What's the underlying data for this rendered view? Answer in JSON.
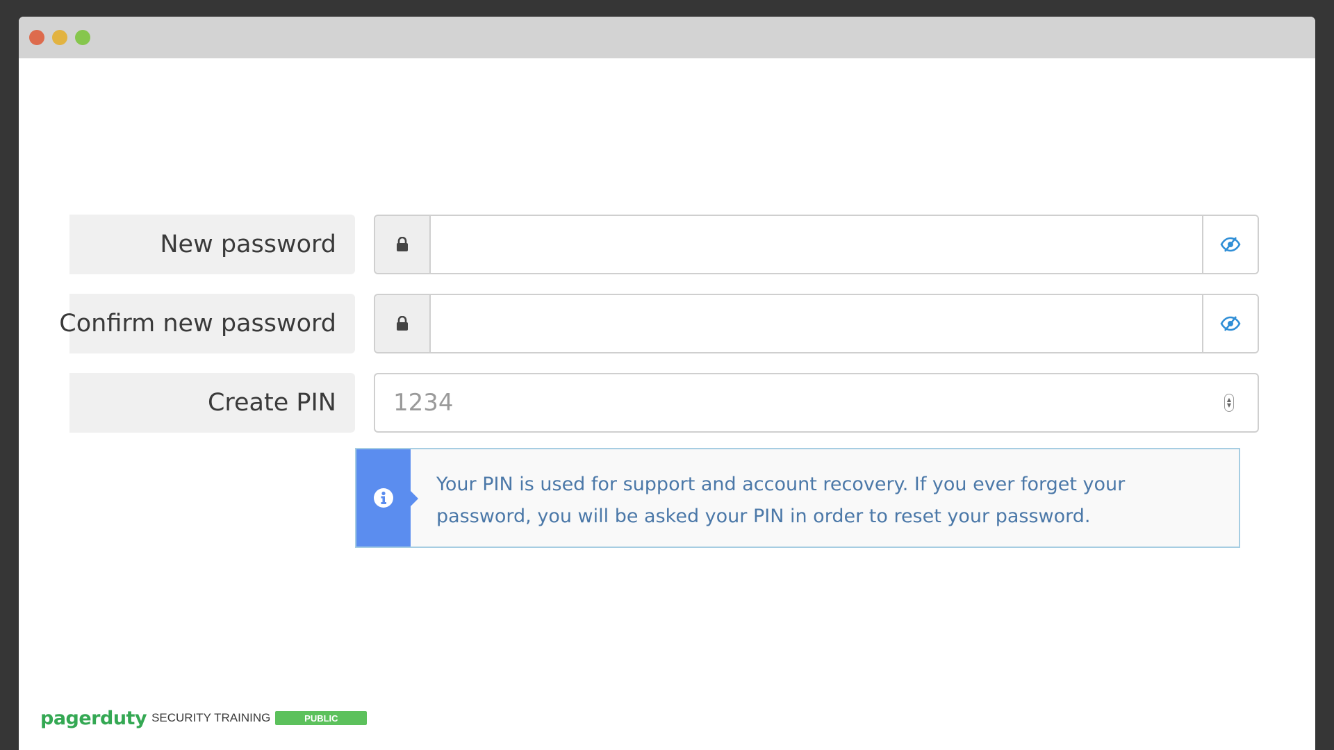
{
  "window": {
    "controls": [
      "close",
      "minimize",
      "maximize"
    ]
  },
  "form": {
    "new_password": {
      "label": "New password",
      "value": "",
      "lock_icon": "lock-icon",
      "toggle_icon": "eye-slash-icon"
    },
    "confirm_password": {
      "label": "Confirm new password",
      "value": "",
      "lock_icon": "lock-icon",
      "toggle_icon": "eye-slash-icon"
    },
    "pin": {
      "label": "Create PIN",
      "placeholder": "1234",
      "value": ""
    }
  },
  "info": {
    "icon": "info-circle-icon",
    "text": "Your PIN is used for support and account recovery. If you ever forget your password, you will be asked your PIN in order to reset your password."
  },
  "footer": {
    "brand": "pagerduty",
    "training": "SECURITY TRAINING",
    "badge": "PUBLIC"
  },
  "colors": {
    "background": "#363636",
    "titlebar": "#d3d3d3",
    "info_accent": "#5b8def",
    "info_text": "#4b78a8",
    "brand_green": "#34a853",
    "badge_green": "#5cc15c",
    "eye_icon": "#2f8ed6"
  }
}
